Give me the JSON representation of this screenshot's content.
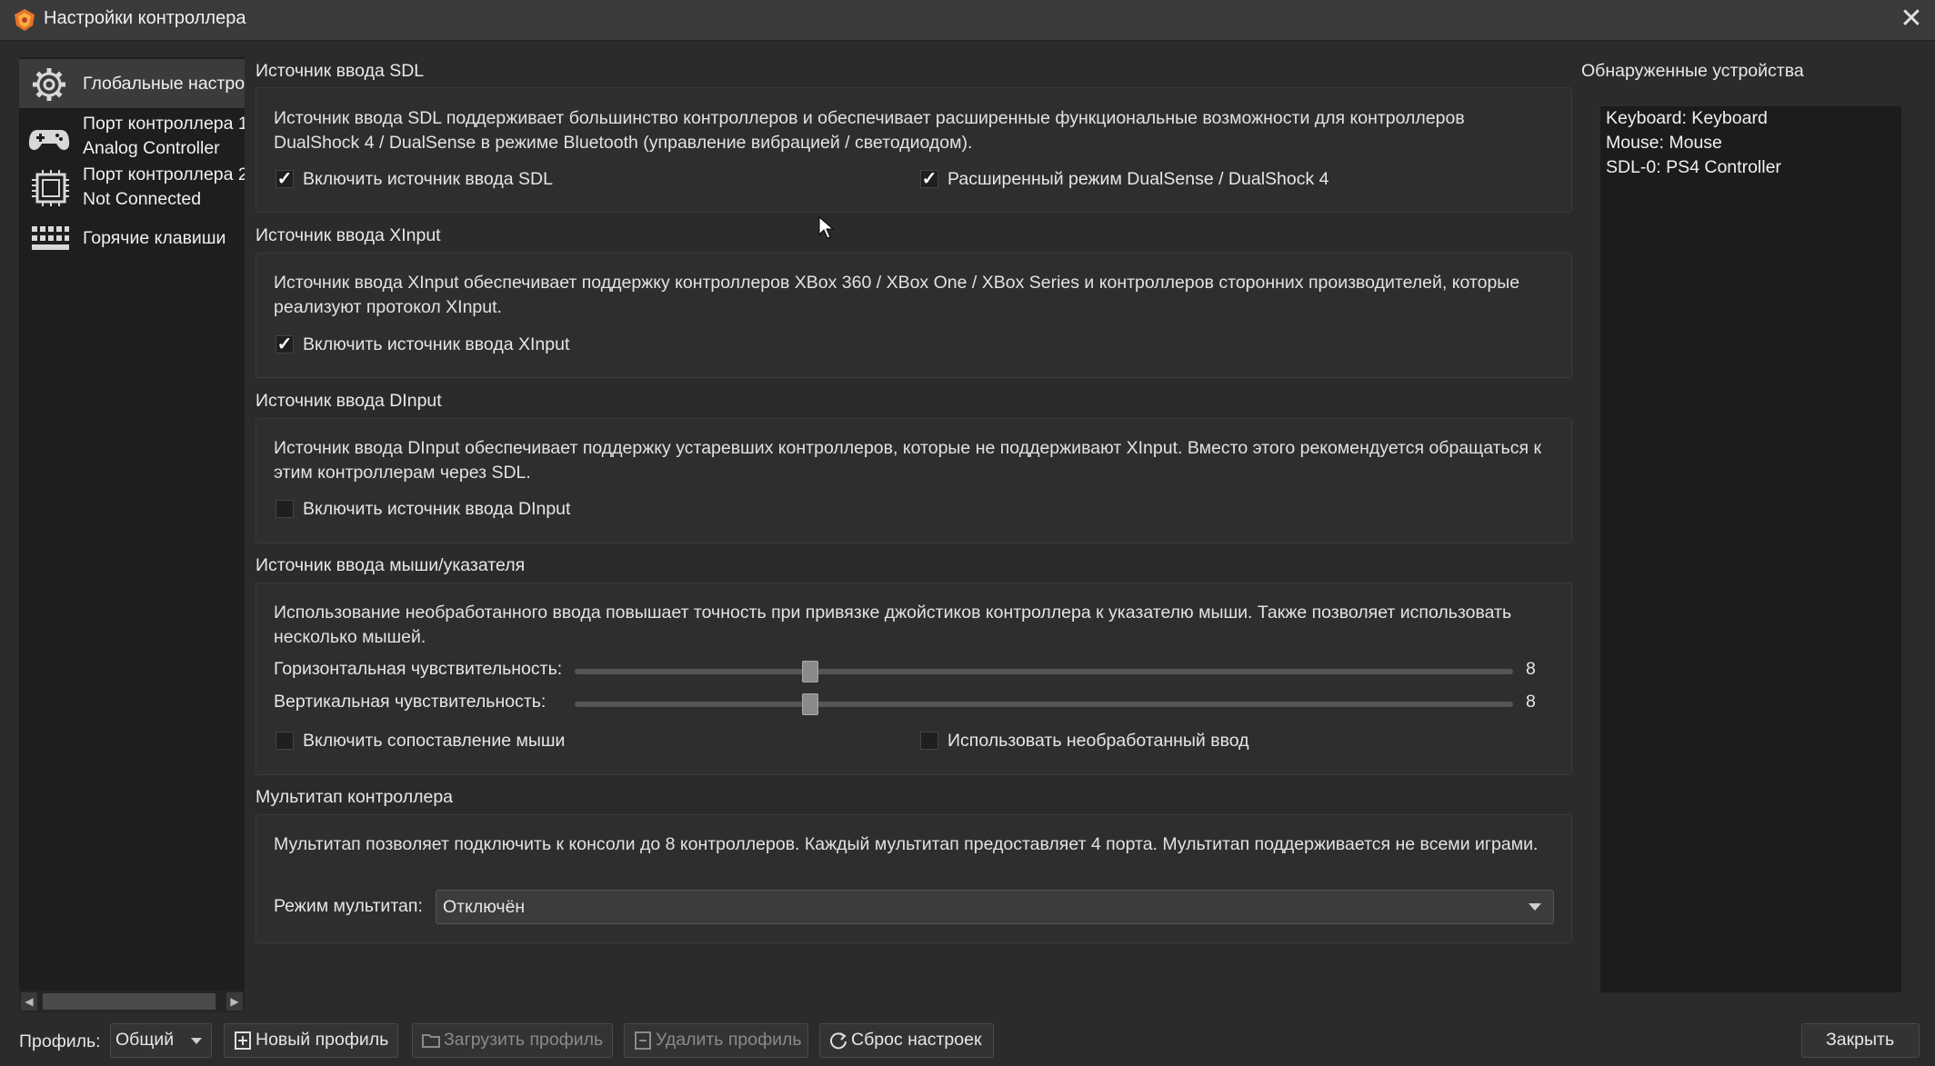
{
  "window": {
    "title": "Настройки контроллера",
    "close_glyph": "✕"
  },
  "sidebar": {
    "items": [
      {
        "icon": "gear-icon",
        "line1": "Глобальные настро",
        "line2": ""
      },
      {
        "icon": "gamepad-icon",
        "line1": "Порт контроллера 1",
        "line2": "Analog Controller"
      },
      {
        "icon": "chip-icon",
        "line1": "Порт контроллера 2",
        "line2": "Not Connected"
      },
      {
        "icon": "keyboard-icon",
        "line1": "Горячие клавиши",
        "line2": ""
      }
    ]
  },
  "sdl": {
    "title": "Источник ввода SDL",
    "desc": "Источник ввода SDL поддерживает большинство контроллеров и обеспечивает расширенные функциональные возможности для контроллеров DualShock 4 / DualSense в режиме Bluetooth (управление вибрацией / светодиодом).",
    "enable_label": "Включить источник ввода SDL",
    "enable_checked": true,
    "dualsense_label": "Расширенный режим DualSense / DualShock 4",
    "dualsense_checked": true
  },
  "xinput": {
    "title": "Источник ввода XInput",
    "desc": "Источник ввода XInput обеспечивает поддержку контроллеров XBox 360 / XBox One / XBox Series и контроллеров сторонних производителей, которые реализуют протокол XInput.",
    "enable_label": "Включить источник ввода XInput",
    "enable_checked": true
  },
  "dinput": {
    "title": "Источник ввода DInput",
    "desc": "Источник ввода DInput обеспечивает поддержку устаревших контроллеров, которые не поддерживают XInput. Вместо этого рекомендуется обращаться к этим контроллерам через SDL.",
    "enable_label": "Включить источник ввода DInput",
    "enable_checked": false
  },
  "mouse": {
    "title": "Источник ввода мыши/указателя",
    "desc": "Использование необработанного ввода повышает точность при привязке джойстиков контроллера к указателю мыши. Также позволяет использовать несколько мышей.",
    "h_label": "Горизонтальная чувствительность:",
    "h_value": "8",
    "h_fraction": 0.25,
    "v_label": "Вертикальная чувствительность:",
    "v_value": "8",
    "v_fraction": 0.25,
    "mapping_label": "Включить сопоставление мыши",
    "mapping_checked": false,
    "raw_label": "Использовать необработанный ввод",
    "raw_checked": false
  },
  "multitap": {
    "title": "Мультитап контроллера",
    "desc": "Мультитап позволяет подключить к консоли до 8 контроллеров. Каждый мультитап предоставляет 4 порта. Мультитап поддерживается не всеми играми.",
    "mode_label": "Режим мультитап:",
    "mode_value": "Отключён"
  },
  "devices": {
    "title": "Обнаруженные устройства",
    "items": [
      "Keyboard: Keyboard",
      "Mouse: Mouse",
      "SDL-0: PS4 Controller"
    ]
  },
  "bottom": {
    "profile_label": "Профиль:",
    "profile_value": "Общий",
    "new_profile": "Новый профиль",
    "load_profile": "Загрузить профиль",
    "delete_profile": "Удалить профиль",
    "reset": "Сброс настроек",
    "close": "Закрыть"
  },
  "colors": {
    "background": "#2b2b2b",
    "sidebar": "#1e1e1e",
    "sidebar_active": "#3b3b3b",
    "text": "#e6e6e6",
    "disabled_text": "#8a8a8a"
  }
}
